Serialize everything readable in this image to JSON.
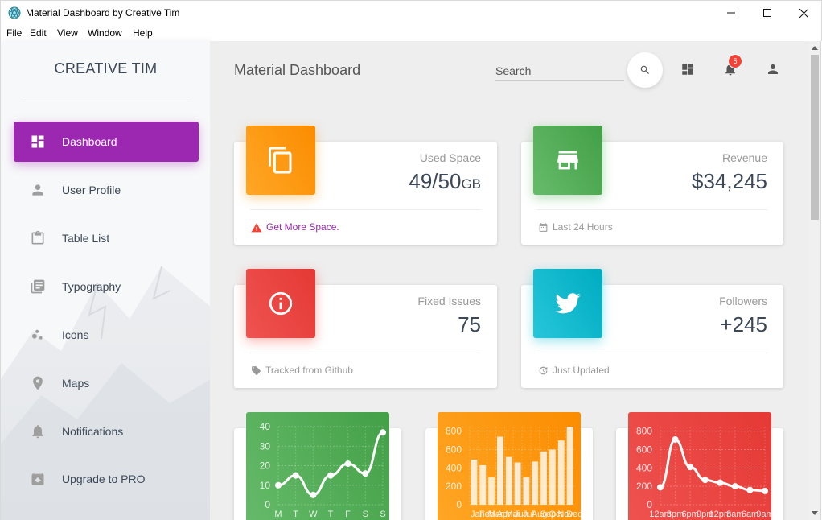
{
  "window": {
    "title": "Material Dashboard by Creative Tim"
  },
  "menu": [
    "File",
    "Edit",
    "View",
    "Window",
    "Help"
  ],
  "sidebar": {
    "brand": "CREATIVE TIM",
    "items": [
      {
        "label": "Dashboard",
        "icon": "dashboard-icon",
        "active": true
      },
      {
        "label": "User Profile",
        "icon": "person-icon"
      },
      {
        "label": "Table List",
        "icon": "clipboard-icon"
      },
      {
        "label": "Typography",
        "icon": "library-books-icon"
      },
      {
        "label": "Icons",
        "icon": "bubble-chart-icon"
      },
      {
        "label": "Maps",
        "icon": "location-icon"
      },
      {
        "label": "Notifications",
        "icon": "bell-icon"
      },
      {
        "label": "Upgrade to PRO",
        "icon": "unarchive-icon"
      }
    ]
  },
  "header": {
    "title": "Material Dashboard",
    "search_placeholder": "Search",
    "notification_count": "5"
  },
  "stats": [
    {
      "category": "Used Space",
      "value": "49/50",
      "unit": "GB",
      "footer": "Get More Space.",
      "icon": "content-copy-icon",
      "color": "#ff9800"
    },
    {
      "category": "Revenue",
      "value": "$34,245",
      "footer": "Last 24 Hours",
      "icon": "store-icon",
      "color": "#4caf50"
    },
    {
      "category": "Fixed Issues",
      "value": "75",
      "footer": "Tracked from Github",
      "icon": "info-outline-icon",
      "color": "#f44336"
    },
    {
      "category": "Followers",
      "value": "+245",
      "footer": "Just Updated",
      "icon": "twitter-icon",
      "color": "#00bcd4"
    }
  ],
  "chart_data": [
    {
      "type": "line",
      "color": "#4caf50",
      "categories": [
        "M",
        "T",
        "W",
        "T",
        "F",
        "S",
        "S"
      ],
      "values": [
        10,
        15,
        5,
        15,
        21,
        16,
        37
      ],
      "ylim": [
        0,
        40
      ],
      "yticks": [
        0,
        10,
        20,
        30,
        40
      ],
      "grid": true
    },
    {
      "type": "bar",
      "color": "#ff9800",
      "categories": [
        "Jan",
        "Feb",
        "Mar",
        "Apr",
        "Mai",
        "Jun",
        "Jul",
        "Aug",
        "Sep",
        "Oct",
        "Nov",
        "Dec"
      ],
      "values": [
        490,
        430,
        300,
        740,
        520,
        460,
        300,
        470,
        580,
        600,
        700,
        850
      ],
      "ylim": [
        0,
        850
      ],
      "yticks": [
        0,
        200,
        400,
        600,
        800
      ],
      "grid": true
    },
    {
      "type": "line",
      "color": "#f44336",
      "categories": [
        "12am",
        "3pm",
        "6pm",
        "9pm",
        "12pm",
        "3am",
        "6am",
        "9am"
      ],
      "values": [
        190,
        710,
        410,
        270,
        240,
        200,
        160,
        150
      ],
      "ylim": [
        0,
        850
      ],
      "yticks": [
        0,
        200,
        400,
        600,
        800
      ],
      "grid": true
    }
  ]
}
